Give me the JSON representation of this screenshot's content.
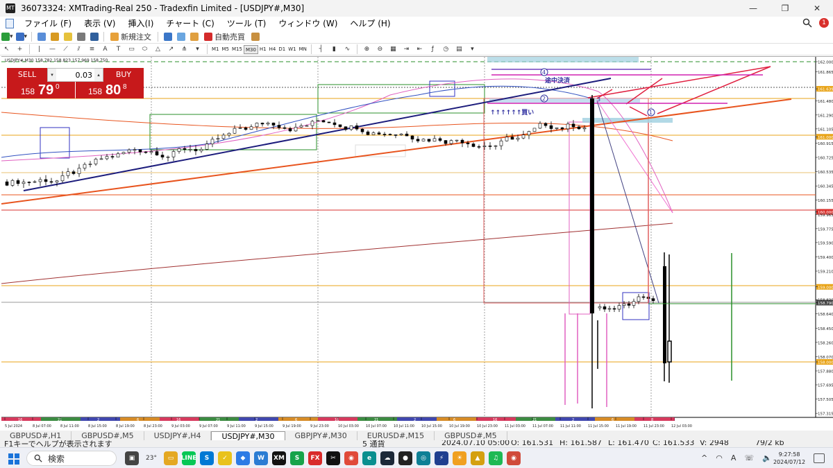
{
  "window": {
    "title": "36073324: XMTrading-Real 250 - Tradexfin Limited - [USDJPY#,M30]",
    "app_icon": "MT",
    "controls": [
      "—",
      "❐",
      "✕"
    ]
  },
  "menu": [
    "ファイル (F)",
    "表示 (V)",
    "挿入(I)",
    "チャート (C)",
    "ツール (T)",
    "ウィンドウ (W)",
    "ヘルプ (H)"
  ],
  "toolbar": {
    "new_order_label": "新規注文",
    "autotrade_label": "自動売買",
    "notification_count": "1",
    "timeframes": [
      "M1",
      "M5",
      "M15",
      "M30",
      "H1",
      "H4",
      "D1",
      "W1",
      "MN"
    ],
    "active_timeframe": "M30"
  },
  "chart": {
    "header": "USDJPY#,M30  158.782 158.823 157.969 158.750",
    "price_labels": [
      "162.000",
      "161.865",
      "161.639",
      "161.480",
      "161.290",
      "161.105",
      "161.000",
      "160.915",
      "160.725",
      "160.535",
      "160.345",
      "160.155",
      "160.000",
      "159.965",
      "159.775",
      "159.590",
      "159.400",
      "159.210",
      "159.000",
      "158.830",
      "158.790",
      "158.640",
      "158.450",
      "158.260",
      "158.070",
      "158.000",
      "157.880",
      "157.695",
      "157.505",
      "157.315"
    ],
    "highlighted_prices": [
      "161.639",
      "161.000",
      "160.000",
      "159.000",
      "158.790",
      "158.000"
    ],
    "time_labels": [
      "5 Jul 2024",
      "8 Jul 07:00",
      "8 Jul 11:00",
      "8 Jul 15:00",
      "8 Jul 19:00",
      "8 Jul 23:00",
      "9 Jul 03:00",
      "9 Jul 07:00",
      "9 Jul 11:00",
      "9 Jul 15:00",
      "9 Jul 19:00",
      "9 Jul 23:00",
      "10 Jul 03:00",
      "10 Jul 07:00",
      "10 Jul 11:00",
      "10 Jul 15:00",
      "10 Jul 19:00",
      "10 Jul 23:00",
      "11 Jul 03:00",
      "11 Jul 07:00",
      "11 Jul 11:00",
      "11 Jul 15:00",
      "11 Jul 19:00",
      "11 Jul 23:00",
      "12 Jul 03:00"
    ],
    "session_markers": [
      "16",
      "21",
      "2",
      "6",
      "16",
      "21",
      "2",
      "6",
      "16",
      "21",
      "2",
      "6",
      "16",
      "21",
      "2",
      "6",
      "8"
    ],
    "annotations": {
      "partial_close": "途中決済",
      "buy_arrows": "↑↑↑↑↑↑買い",
      "wave_4": "4",
      "wave_2": "2",
      "wave_3": "3",
      "wave_1": "1"
    }
  },
  "trade_panel": {
    "sell_label": "SELL",
    "buy_label": "BUY",
    "lot": "0.03",
    "sell_price_small": "158",
    "sell_price_big": "79",
    "sell_price_sup": "0",
    "buy_price_small": "158",
    "buy_price_big": "80",
    "buy_price_sup": "8"
  },
  "tabs": [
    "GBPUSD#,H1",
    "GBPUSD#,M5",
    "USDJPY#,H4",
    "USDJPY#,M30",
    "GBPJPY#,M30",
    "EURUSD#,M15",
    "GBPUSD#,M5"
  ],
  "active_tab": "USDJPY#,M30",
  "status": {
    "help": "F1キーでヘルプが表示されます",
    "profile": "5 通貨",
    "datetime": "2024.07.10 05:00",
    "open": "O: 161.531",
    "high": "H: 161.587",
    "low": "L: 161.470",
    "close": "C: 161.533",
    "volume": "V: 2948",
    "traffic": "79/2 kb"
  },
  "taskbar": {
    "search_placeholder": "検索",
    "weather": "23°",
    "time": "9:27:58",
    "date": "2024/07/12",
    "apps": [
      {
        "name": "task-view",
        "color": "#444",
        "label": "▣"
      },
      {
        "name": "file-explorer",
        "color": "#e4a823",
        "label": "▭"
      },
      {
        "name": "line",
        "color": "#06c755",
        "label": "LINE"
      },
      {
        "name": "skype",
        "color": "#0078d4",
        "label": "S"
      },
      {
        "name": "tick",
        "color": "#e9c21c",
        "label": "✓"
      },
      {
        "name": "app-blue",
        "color": "#2d7be5",
        "label": "◆"
      },
      {
        "name": "word",
        "color": "#2b7cd3",
        "label": "W"
      },
      {
        "name": "xm",
        "color": "#111",
        "label": "XM"
      },
      {
        "name": "money",
        "color": "#16a34a",
        "label": "S"
      },
      {
        "name": "fx",
        "color": "#d92b2b",
        "label": "FX"
      },
      {
        "name": "capcut",
        "color": "#111",
        "label": "✂"
      },
      {
        "name": "chrome",
        "color": "#e04a3a",
        "label": "◉"
      },
      {
        "name": "edge",
        "color": "#0a8f8f",
        "label": "e"
      },
      {
        "name": "steam",
        "color": "#1b2838",
        "label": "☁"
      },
      {
        "name": "obs",
        "color": "#222",
        "label": "●"
      },
      {
        "name": "app-teal",
        "color": "#0e7f95",
        "label": "◎"
      },
      {
        "name": "bolt",
        "color": "#1f3f8f",
        "label": "⚡"
      },
      {
        "name": "sun",
        "color": "#f0a020",
        "label": "☀"
      },
      {
        "name": "app-yellow",
        "color": "#d4a010",
        "label": "▲"
      },
      {
        "name": "spotify",
        "color": "#1db954",
        "label": "♫"
      },
      {
        "name": "chrome-profile",
        "color": "#d04a3a",
        "label": "◉"
      }
    ],
    "tray": [
      "^",
      "◠",
      "A",
      "☏",
      "🔈"
    ]
  },
  "colors": {
    "sell_buy": "#c7191b",
    "bull_trendline": "#1c1c7c",
    "orange_line": "#e8541e",
    "red_line": "#d9302c",
    "magenta": "#e020a0",
    "gold_line": "#e8a317"
  }
}
